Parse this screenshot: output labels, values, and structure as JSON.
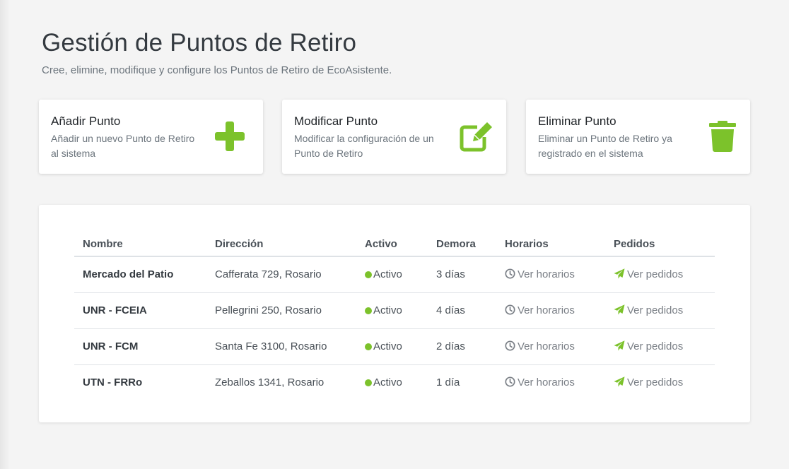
{
  "colors": {
    "accent": "#7cc22b",
    "active_dot": "#7cc22b"
  },
  "header": {
    "title": "Gestión de Puntos de Retiro",
    "subtitle": "Cree, elimine, modifique y configure los Puntos de Retiro de EcoAsistente."
  },
  "cards": [
    {
      "title": "Añadir Punto",
      "description": "Añadir un nuevo Punto de Retiro al sistema",
      "icon": "plus-icon"
    },
    {
      "title": "Modificar Punto",
      "description": "Modificar la configuración de un Punto de Retiro",
      "icon": "edit-icon"
    },
    {
      "title": "Eliminar Punto",
      "description": "Eliminar un Punto de Retiro ya registrado en el sistema",
      "icon": "trash-icon"
    }
  ],
  "table": {
    "headers": [
      "Nombre",
      "Dirección",
      "Activo",
      "Demora",
      "Horarios",
      "Pedidos"
    ],
    "rows": [
      {
        "name": "Mercado del Patio",
        "address": "Cafferata 729, Rosario",
        "active": "Activo",
        "delay": "3 días",
        "schedule": "Ver horarios",
        "orders": "Ver pedidos"
      },
      {
        "name": "UNR - FCEIA",
        "address": "Pellegrini 250, Rosario",
        "active": "Activo",
        "delay": "4 días",
        "schedule": "Ver horarios",
        "orders": "Ver pedidos"
      },
      {
        "name": "UNR - FCM",
        "address": "Santa Fe 3100, Rosario",
        "active": "Activo",
        "delay": "2 días",
        "schedule": "Ver horarios",
        "orders": "Ver pedidos"
      },
      {
        "name": "UTN - FRRo",
        "address": "Zeballos 1341, Rosario",
        "active": "Activo",
        "delay": "1 día",
        "schedule": "Ver horarios",
        "orders": "Ver pedidos"
      }
    ]
  }
}
